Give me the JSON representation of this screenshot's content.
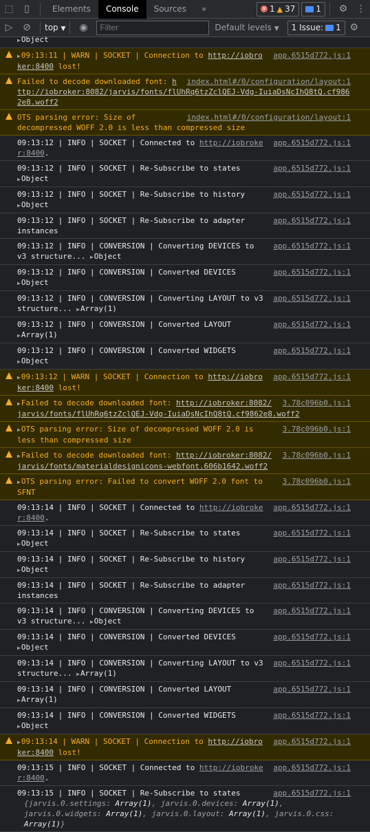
{
  "toolbar": {
    "tabs": [
      "Elements",
      "Console",
      "Sources"
    ],
    "active_tab": "Console",
    "more": "»",
    "errors": "1",
    "warnings": "37",
    "messages": "1"
  },
  "console_bar": {
    "context": "top",
    "filter_placeholder": "Filter",
    "levels": "Default levels",
    "issues_label": "1 Issue:",
    "issues_count": "1"
  },
  "colors": {
    "warn_bg": "#332b00",
    "warn_text": "#f2ab26",
    "info_text": "#e8eaed",
    "bg": "#202124"
  },
  "log": [
    {
      "level": "info",
      "obj": "Object"
    },
    {
      "level": "warn",
      "expander": true,
      "text": "09:13:11 | WARN | SOCKET | Connection to ",
      "link": "http://iobroker:8400",
      "suffix": " lost!",
      "source": "app.6515d772.js:1"
    },
    {
      "level": "warn",
      "text": "Failed to decode downloaded font: ",
      "link": "http://iobroker:8082/jarvis/fonts/flUhRq6tzZclQEJ-Vdg-IuiaDsNcIhQ8tQ.cf9862e8.woff2",
      "source": "index.html#/0/configuration/layout:1"
    },
    {
      "level": "warn",
      "text": "OTS parsing error: Size of decompressed WOFF 2.0 is less than compressed size",
      "source": "index.html#/0/configuration/layout:1"
    },
    {
      "level": "info",
      "text": "09:13:12 | INFO | SOCKET | Connected to ",
      "link": "http://iobroker:8400",
      "suffix": ".",
      "source": "app.6515d772.js:1"
    },
    {
      "level": "info",
      "text": "09:13:12 | INFO | SOCKET | Re-Subscribe to states",
      "obj": "Object",
      "source": "app.6515d772.js:1"
    },
    {
      "level": "info",
      "text": "09:13:12 | INFO | SOCKET | Re-Subscribe to history",
      "obj": "Object",
      "source": "app.6515d772.js:1"
    },
    {
      "level": "info",
      "text": "09:13:12 | INFO | SOCKET | Re-Subscribe to adapter instances",
      "source": "app.6515d772.js:1"
    },
    {
      "level": "info",
      "text": "09:13:12 | INFO | CONVERSION | Converting DEVICES to v3 structure...",
      "obj": "Object",
      "source": "app.6515d772.js:1"
    },
    {
      "level": "info",
      "text": "09:13:12 | INFO | CONVERSION | Converted DEVICES",
      "obj": "Object",
      "source": "app.6515d772.js:1"
    },
    {
      "level": "info",
      "text": "09:13:12 | INFO | CONVERSION | Converting LAYOUT to v3 structure...",
      "obj": "Array(1)",
      "source": "app.6515d772.js:1"
    },
    {
      "level": "info",
      "text": "09:13:12 | INFO | CONVERSION | Converted LAYOUT",
      "obj": "Array(1)",
      "source": "app.6515d772.js:1"
    },
    {
      "level": "info",
      "text": "09:13:12 | INFO | CONVERSION | Converted WIDGETS",
      "obj": "Object",
      "source": "app.6515d772.js:1"
    },
    {
      "level": "warn",
      "expander": true,
      "text": "09:13:12 | WARN | SOCKET | Connection to ",
      "link": "http://iobroker:8400",
      "suffix": " lost!",
      "source": "app.6515d772.js:1"
    },
    {
      "level": "warn",
      "expander": true,
      "text": "Failed to decode downloaded font: ",
      "link": "http://iobroker:8082/jarvis/fonts/flUhRq6tzZclQEJ-Vdg-IuiaDsNcIhQ8tQ.cf9862e8.woff2",
      "source": "3.78c096b0.js:1"
    },
    {
      "level": "warn",
      "expander": true,
      "text": "OTS parsing error: Size of decompressed WOFF 2.0 is less than compressed size",
      "source": "3.78c096b0.js:1"
    },
    {
      "level": "warn",
      "expander": true,
      "text": "Failed to decode downloaded font: ",
      "link": "http://iobroker:8082/jarvis/fonts/materialdesignicons-webfont.606b1642.woff2",
      "source": "3.78c096b0.js:1"
    },
    {
      "level": "warn",
      "expander": true,
      "text": "OTS parsing error: Failed to convert WOFF 2.0 font to SFNT",
      "source": "3.78c096b0.js:1"
    },
    {
      "level": "info",
      "text": "09:13:14 | INFO | SOCKET | Connected to ",
      "link": "http://iobroker:8400",
      "suffix": ".",
      "source": "app.6515d772.js:1"
    },
    {
      "level": "info",
      "text": "09:13:14 | INFO | SOCKET | Re-Subscribe to states",
      "obj": "Object",
      "source": "app.6515d772.js:1"
    },
    {
      "level": "info",
      "text": "09:13:14 | INFO | SOCKET | Re-Subscribe to history",
      "obj": "Object",
      "source": "app.6515d772.js:1"
    },
    {
      "level": "info",
      "text": "09:13:14 | INFO | SOCKET | Re-Subscribe to adapter instances",
      "source": "app.6515d772.js:1"
    },
    {
      "level": "info",
      "text": "09:13:14 | INFO | CONVERSION | Converting DEVICES to v3 structure...",
      "obj": "Object",
      "source": "app.6515d772.js:1"
    },
    {
      "level": "info",
      "text": "09:13:14 | INFO | CONVERSION | Converted DEVICES",
      "obj": "Object",
      "source": "app.6515d772.js:1"
    },
    {
      "level": "info",
      "text": "09:13:14 | INFO | CONVERSION | Converting LAYOUT to v3 structure...",
      "obj": "Array(1)",
      "source": "app.6515d772.js:1"
    },
    {
      "level": "info",
      "text": "09:13:14 | INFO | CONVERSION | Converted LAYOUT",
      "obj": "Array(1)",
      "source": "app.6515d772.js:1"
    },
    {
      "level": "info",
      "text": "09:13:14 | INFO | CONVERSION | Converted WIDGETS",
      "obj": "Object",
      "source": "app.6515d772.js:1"
    },
    {
      "level": "warn",
      "expander": true,
      "text": "09:13:14 | WARN | SOCKET | Connection to ",
      "link": "http://iobroker:8400",
      "suffix": " lost!",
      "source": "app.6515d772.js:1"
    },
    {
      "level": "info",
      "text": "09:13:15 | INFO | SOCKET | Connected to ",
      "link": "http://iobroker:8400",
      "suffix": ".",
      "source": "app.6515d772.js:1"
    },
    {
      "level": "info",
      "text": "09:13:15 | INFO | SOCKET | Re-Subscribe to states",
      "source": "app.6515d772.js:1",
      "preview": [
        [
          "jarvis.0.settings",
          "Array(1)"
        ],
        [
          "jarvis.0.devices",
          "Array(1)"
        ],
        [
          "jarvis.0.widgets",
          "Array(1)"
        ],
        [
          "jarvis.0.layout",
          "Array(1)"
        ],
        [
          "jarvis.0.css",
          "Array(1)"
        ]
      ]
    }
  ]
}
